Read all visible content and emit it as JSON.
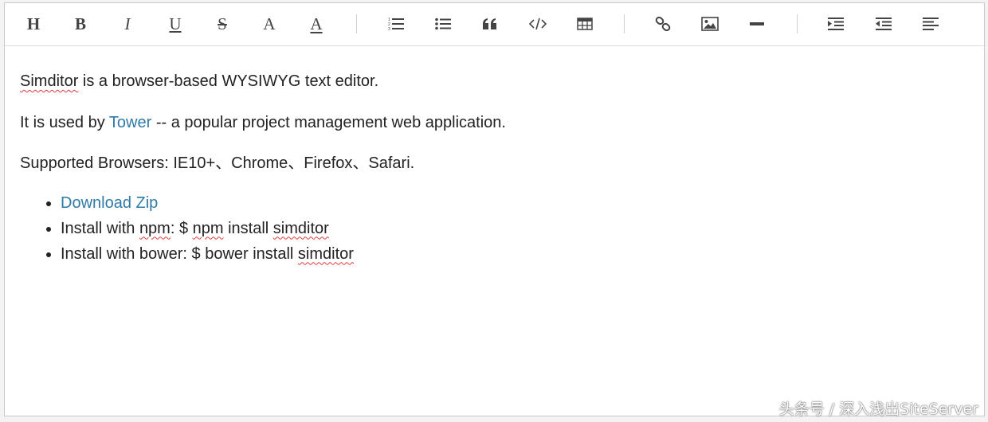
{
  "toolbar": {
    "buttons": [
      {
        "id": "title",
        "label": "H",
        "icon": "heading-icon"
      },
      {
        "id": "bold",
        "label": "B",
        "icon": "bold-icon"
      },
      {
        "id": "italic",
        "label": "I",
        "icon": "italic-icon"
      },
      {
        "id": "underline",
        "label": "U",
        "icon": "underline-icon"
      },
      {
        "id": "strikethrough",
        "label": "S",
        "icon": "strikethrough-icon"
      },
      {
        "id": "fontScale",
        "label": "A",
        "icon": "font-size-icon"
      },
      {
        "id": "color",
        "label": "A",
        "icon": "font-color-icon"
      },
      {
        "id": "ol",
        "icon": "ordered-list-icon"
      },
      {
        "id": "ul",
        "icon": "unordered-list-icon"
      },
      {
        "id": "blockquote",
        "icon": "blockquote-icon"
      },
      {
        "id": "code",
        "icon": "code-icon"
      },
      {
        "id": "table",
        "icon": "table-icon"
      },
      {
        "id": "link",
        "icon": "link-icon"
      },
      {
        "id": "image",
        "icon": "image-icon"
      },
      {
        "id": "hr",
        "icon": "horizontal-rule-icon"
      },
      {
        "id": "indent",
        "icon": "indent-icon"
      },
      {
        "id": "outdent",
        "icon": "outdent-icon"
      },
      {
        "id": "alignment",
        "icon": "align-left-icon"
      }
    ]
  },
  "content": {
    "p1": {
      "word": "Simditor",
      "rest": " is a browser-based WYSIWYG text editor."
    },
    "p2": {
      "before": "It is used by ",
      "link": "Tower",
      "after": " -- a popular project management web application."
    },
    "p3": "Supported Browsers: IE10+、Chrome、Firefox、Safari.",
    "list": {
      "item1": "Download Zip",
      "item2": {
        "a": "Install with ",
        "b": "npm",
        "c": ": $ ",
        "d": "npm",
        "e": " install ",
        "f": "simditor"
      },
      "item3": {
        "a": "Install with bower: $ bower install ",
        "b": "simditor"
      }
    }
  },
  "colors": {
    "link": "#2f7aa6",
    "text": "#222222",
    "toolbar_icon": "#444444",
    "spellcheck": "#e03b3b"
  },
  "watermark": "头条号 / 深入浅出SiteServer"
}
